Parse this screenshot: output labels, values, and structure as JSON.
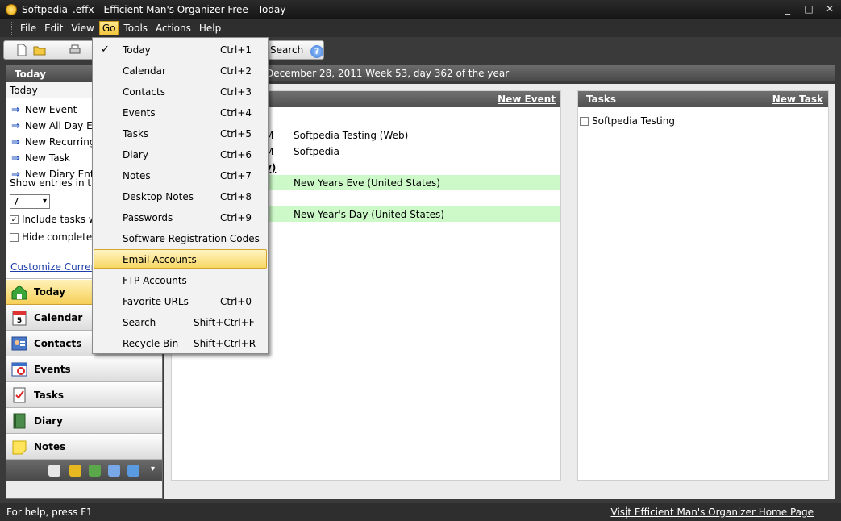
{
  "window": {
    "title": "Softpedia_.effx - Efficient Man's Organizer Free - Today",
    "controls": [
      "_",
      "□",
      "✕"
    ]
  },
  "menubar": {
    "items": [
      {
        "label": "File"
      },
      {
        "label": "Edit"
      },
      {
        "label": "View"
      },
      {
        "label": "Go"
      },
      {
        "label": "Tools"
      },
      {
        "label": "Actions"
      },
      {
        "label": "Help"
      }
    ]
  },
  "toolbar": {
    "search_label": "Search",
    "help_label": "?"
  },
  "left_panel": {
    "header": "Today",
    "sub_header": "Today",
    "quick_actions": [
      {
        "label": "New Event"
      },
      {
        "label": "New All Day Eve"
      },
      {
        "label": "New Recurring E"
      },
      {
        "label": "New Task"
      },
      {
        "label": "New Diary Entry"
      }
    ],
    "show_entries_label": "Show entries in these",
    "days_value": "7",
    "include_tasks_label": "Include tasks with",
    "include_tasks_checked": true,
    "hide_completed_label": "Hide completed ta",
    "hide_completed_checked": false,
    "customize_link": "Customize Current Vie",
    "nav": [
      {
        "label": "Today",
        "icon": "home-icon",
        "active": true
      },
      {
        "label": "Calendar",
        "icon": "calendar-icon",
        "active": false
      },
      {
        "label": "Contacts",
        "icon": "contacts-icon",
        "active": false
      },
      {
        "label": "Events",
        "icon": "events-icon",
        "active": false
      },
      {
        "label": "Tasks",
        "icon": "tasks-icon",
        "active": false
      },
      {
        "label": "Diary",
        "icon": "diary-icon",
        "active": false
      },
      {
        "label": "Notes",
        "icon": "notes-icon",
        "active": false
      }
    ]
  },
  "main": {
    "info": "December 28, 2011   Week 53, day 362 of the year",
    "events_panel": {
      "new_link": "New Event",
      "rows": [
        {
          "time": "M",
          "text": "Softpedia Testing (Web)",
          "highlight": false
        },
        {
          "time": "M",
          "text": "Softpedia",
          "highlight": false
        },
        {
          "time": "y)",
          "text": "",
          "highlight": false
        },
        {
          "time": "",
          "text": "New Years Eve (United States)",
          "highlight": true
        },
        {
          "time": "",
          "text": "New Year's Day (United States)",
          "highlight": true
        }
      ]
    },
    "tasks_panel": {
      "title": "Tasks",
      "new_link": "New Task",
      "items": [
        {
          "label": "Softpedia Testing",
          "checked": false
        }
      ]
    }
  },
  "go_menu": {
    "items": [
      {
        "label": "Today",
        "shortcut": "Ctrl+1",
        "checked": true
      },
      {
        "label": "Calendar",
        "shortcut": "Ctrl+2"
      },
      {
        "label": "Contacts",
        "shortcut": "Ctrl+3"
      },
      {
        "label": "Events",
        "shortcut": "Ctrl+4"
      },
      {
        "label": "Tasks",
        "shortcut": "Ctrl+5"
      },
      {
        "label": "Diary",
        "shortcut": "Ctrl+6"
      },
      {
        "label": "Notes",
        "shortcut": "Ctrl+7"
      },
      {
        "label": "Desktop Notes",
        "shortcut": "Ctrl+8"
      },
      {
        "label": "Passwords",
        "shortcut": "Ctrl+9"
      },
      {
        "label": "Software Registration Codes",
        "shortcut": ""
      },
      {
        "label": "Email Accounts",
        "shortcut": "",
        "highlight": true
      },
      {
        "label": "FTP Accounts",
        "shortcut": ""
      },
      {
        "label": "Favorite URLs",
        "shortcut": "Ctrl+0"
      },
      {
        "label": "Search",
        "shortcut": "Shift+Ctrl+F"
      },
      {
        "label": "Recycle Bin",
        "shortcut": "Shift+Ctrl+R"
      }
    ]
  },
  "statusbar": {
    "help_text": "For help, press F1",
    "home_link": "Visit Efficient Man's Organizer Home Page"
  }
}
